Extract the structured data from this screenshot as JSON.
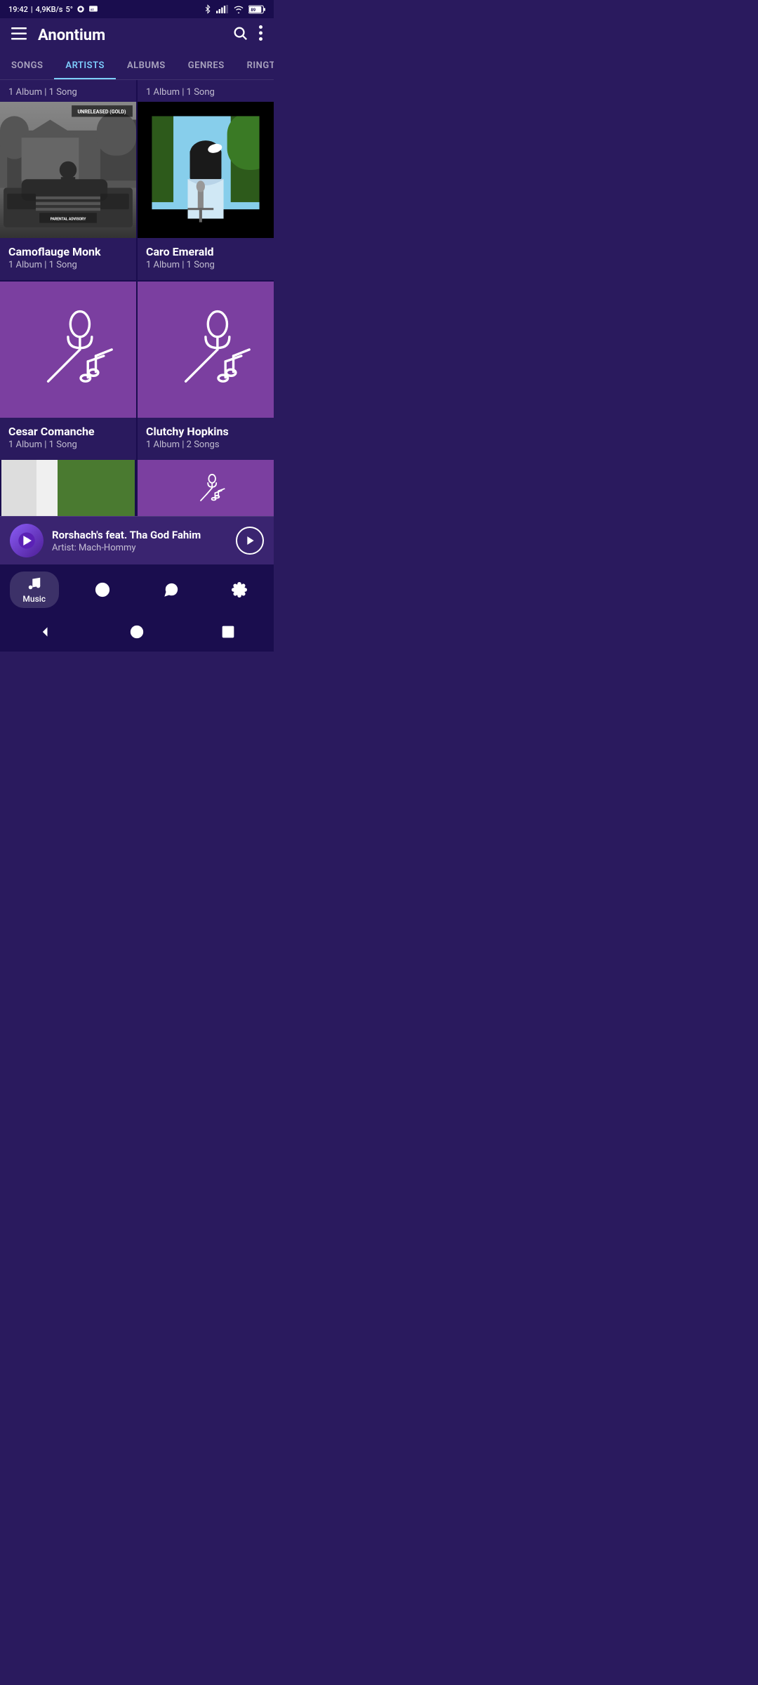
{
  "app": {
    "name": "Anontium",
    "status_bar": {
      "time": "19:42",
      "data_speed": "4,9KB/s",
      "signal_degree": "5°"
    }
  },
  "tabs": [
    {
      "id": "songs",
      "label": "SONGS",
      "active": false
    },
    {
      "id": "artists",
      "label": "ARTISTS",
      "active": true
    },
    {
      "id": "albums",
      "label": "ALBUMS",
      "active": false
    },
    {
      "id": "genres",
      "label": "GENRES",
      "active": false
    },
    {
      "id": "ringtones",
      "label": "RINGTONES",
      "active": false
    }
  ],
  "artists": [
    {
      "id": "camoflauge-monk",
      "name": "Camoflauge Monk",
      "album_count": "1 Album",
      "song_count": "1 Song",
      "has_image": true,
      "image_label": "album cover black white car"
    },
    {
      "id": "caro-emerald",
      "name": "Caro Emerald",
      "album_count": "1 Album",
      "song_count": "1 Song",
      "has_image": true,
      "image_label": "woman singing microphone"
    },
    {
      "id": "cesar-comanche",
      "name": "Cesar Comanche",
      "album_count": "1 Album",
      "song_count": "1 Song",
      "has_image": false
    },
    {
      "id": "clutchy-hopkins",
      "name": "Clutchy Hopkins",
      "album_count": "1 Album",
      "song_count": "2 Songs",
      "has_image": false
    }
  ],
  "partial_artists": [
    {
      "id": "partial-1",
      "has_image": true
    },
    {
      "id": "partial-2",
      "has_image": false
    }
  ],
  "now_playing": {
    "title": "Rorshach's feat. Tha God Fahim",
    "artist": "Artist: Mach-Hommy"
  },
  "bottom_nav": [
    {
      "id": "music",
      "label": "Music",
      "active": true,
      "icon": "music-icon"
    },
    {
      "id": "play",
      "label": "",
      "active": false,
      "icon": "play-icon"
    },
    {
      "id": "share",
      "label": "",
      "active": false,
      "icon": "share-icon"
    },
    {
      "id": "settings",
      "label": "",
      "active": false,
      "icon": "settings-icon"
    }
  ],
  "above_cards_meta": {
    "left": "1 Album | 1 Song",
    "right": "1 Album | 1 Song"
  },
  "colors": {
    "primary": "#2a1a5e",
    "accent": "#7ecfff",
    "purple_card": "#7b3fa0",
    "dark": "#1a0d4e"
  }
}
